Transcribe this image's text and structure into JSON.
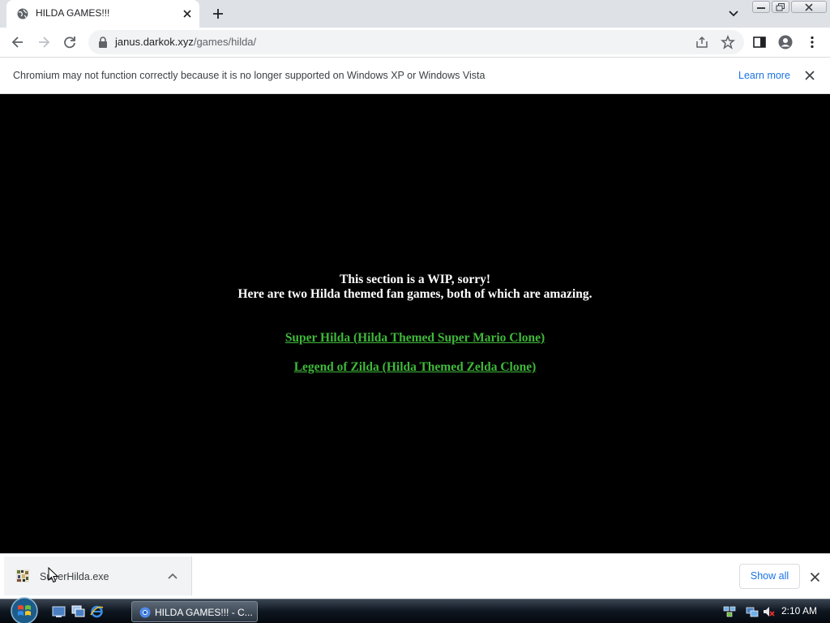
{
  "browser": {
    "tab": {
      "title": "HILDA GAMES!!!",
      "favicon": "globe-icon"
    },
    "toolbar": {
      "url_host": "janus.darkok.xyz",
      "url_path": "/games/hilda/"
    },
    "infobar": {
      "message": "Chromium may not function correctly because it is no longer supported on Windows XP or Windows Vista",
      "link": "Learn more"
    }
  },
  "page": {
    "line1": "This section is a WIP, sorry!",
    "line2": "Here are two Hilda themed fan games, both of which are amazing.",
    "links": [
      {
        "label": "Super Hilda (Hilda Themed Super Mario Clone)"
      },
      {
        "label": "Legend of Zilda (Hilda Themed Zelda Clone)"
      }
    ],
    "link_color": "#3fb83a"
  },
  "downloads": {
    "file_name": "SuperHilda.exe",
    "show_all": "Show all"
  },
  "taskbar": {
    "window_label": "HILDA GAMES!!! - C...",
    "clock": "2:10 AM"
  }
}
